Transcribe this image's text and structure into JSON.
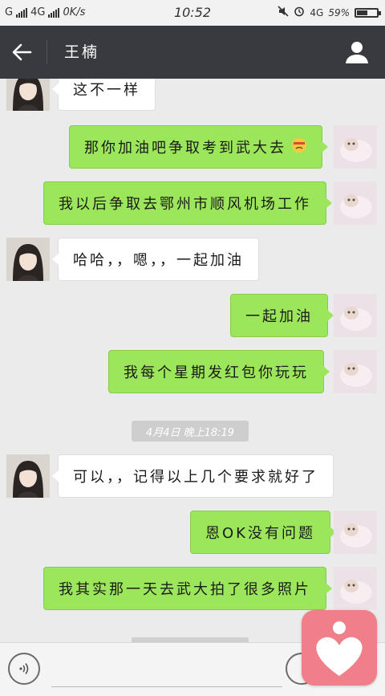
{
  "status_bar": {
    "carrier": "G",
    "network": "4G",
    "speed": "0K/s",
    "time": "10:52",
    "network_right": "4G",
    "battery": "59%",
    "battery_level": 0.59
  },
  "header": {
    "contact_name": "王楠",
    "back_icon": "back-arrow-icon",
    "profile_icon": "person-icon",
    "bg_color": "#393a3f"
  },
  "colors": {
    "my_bubble": "#9be65a",
    "friend_bubble": "#ffffff",
    "chat_bg": "#ebebeb",
    "badge": "#f07f8a"
  },
  "messages": [
    {
      "from": "friend",
      "text": "这不一样"
    },
    {
      "from": "me",
      "text": "那你加油吧争取考到武大去"
    },
    {
      "from": "me",
      "text": "我以后争取去鄂州市顺风机场工作"
    },
    {
      "from": "friend",
      "text": "哈哈，，嗯，，一起加油"
    },
    {
      "from": "me",
      "text": "一起加油"
    },
    {
      "from": "me",
      "text": "我每个星期发红包你玩玩"
    },
    {
      "from": "friend",
      "text": "可以，，记得以上几个要求就好了"
    },
    {
      "from": "me",
      "text": "恩OK没有问题"
    },
    {
      "from": "me",
      "text": "我其实那一天去武大拍了很多照片"
    }
  ],
  "timestamp": "4月4日 晚上18:19",
  "input_bar": {
    "voice_icon": "voice-icon",
    "emoji_icon": "emoji-icon",
    "input_value": ""
  }
}
